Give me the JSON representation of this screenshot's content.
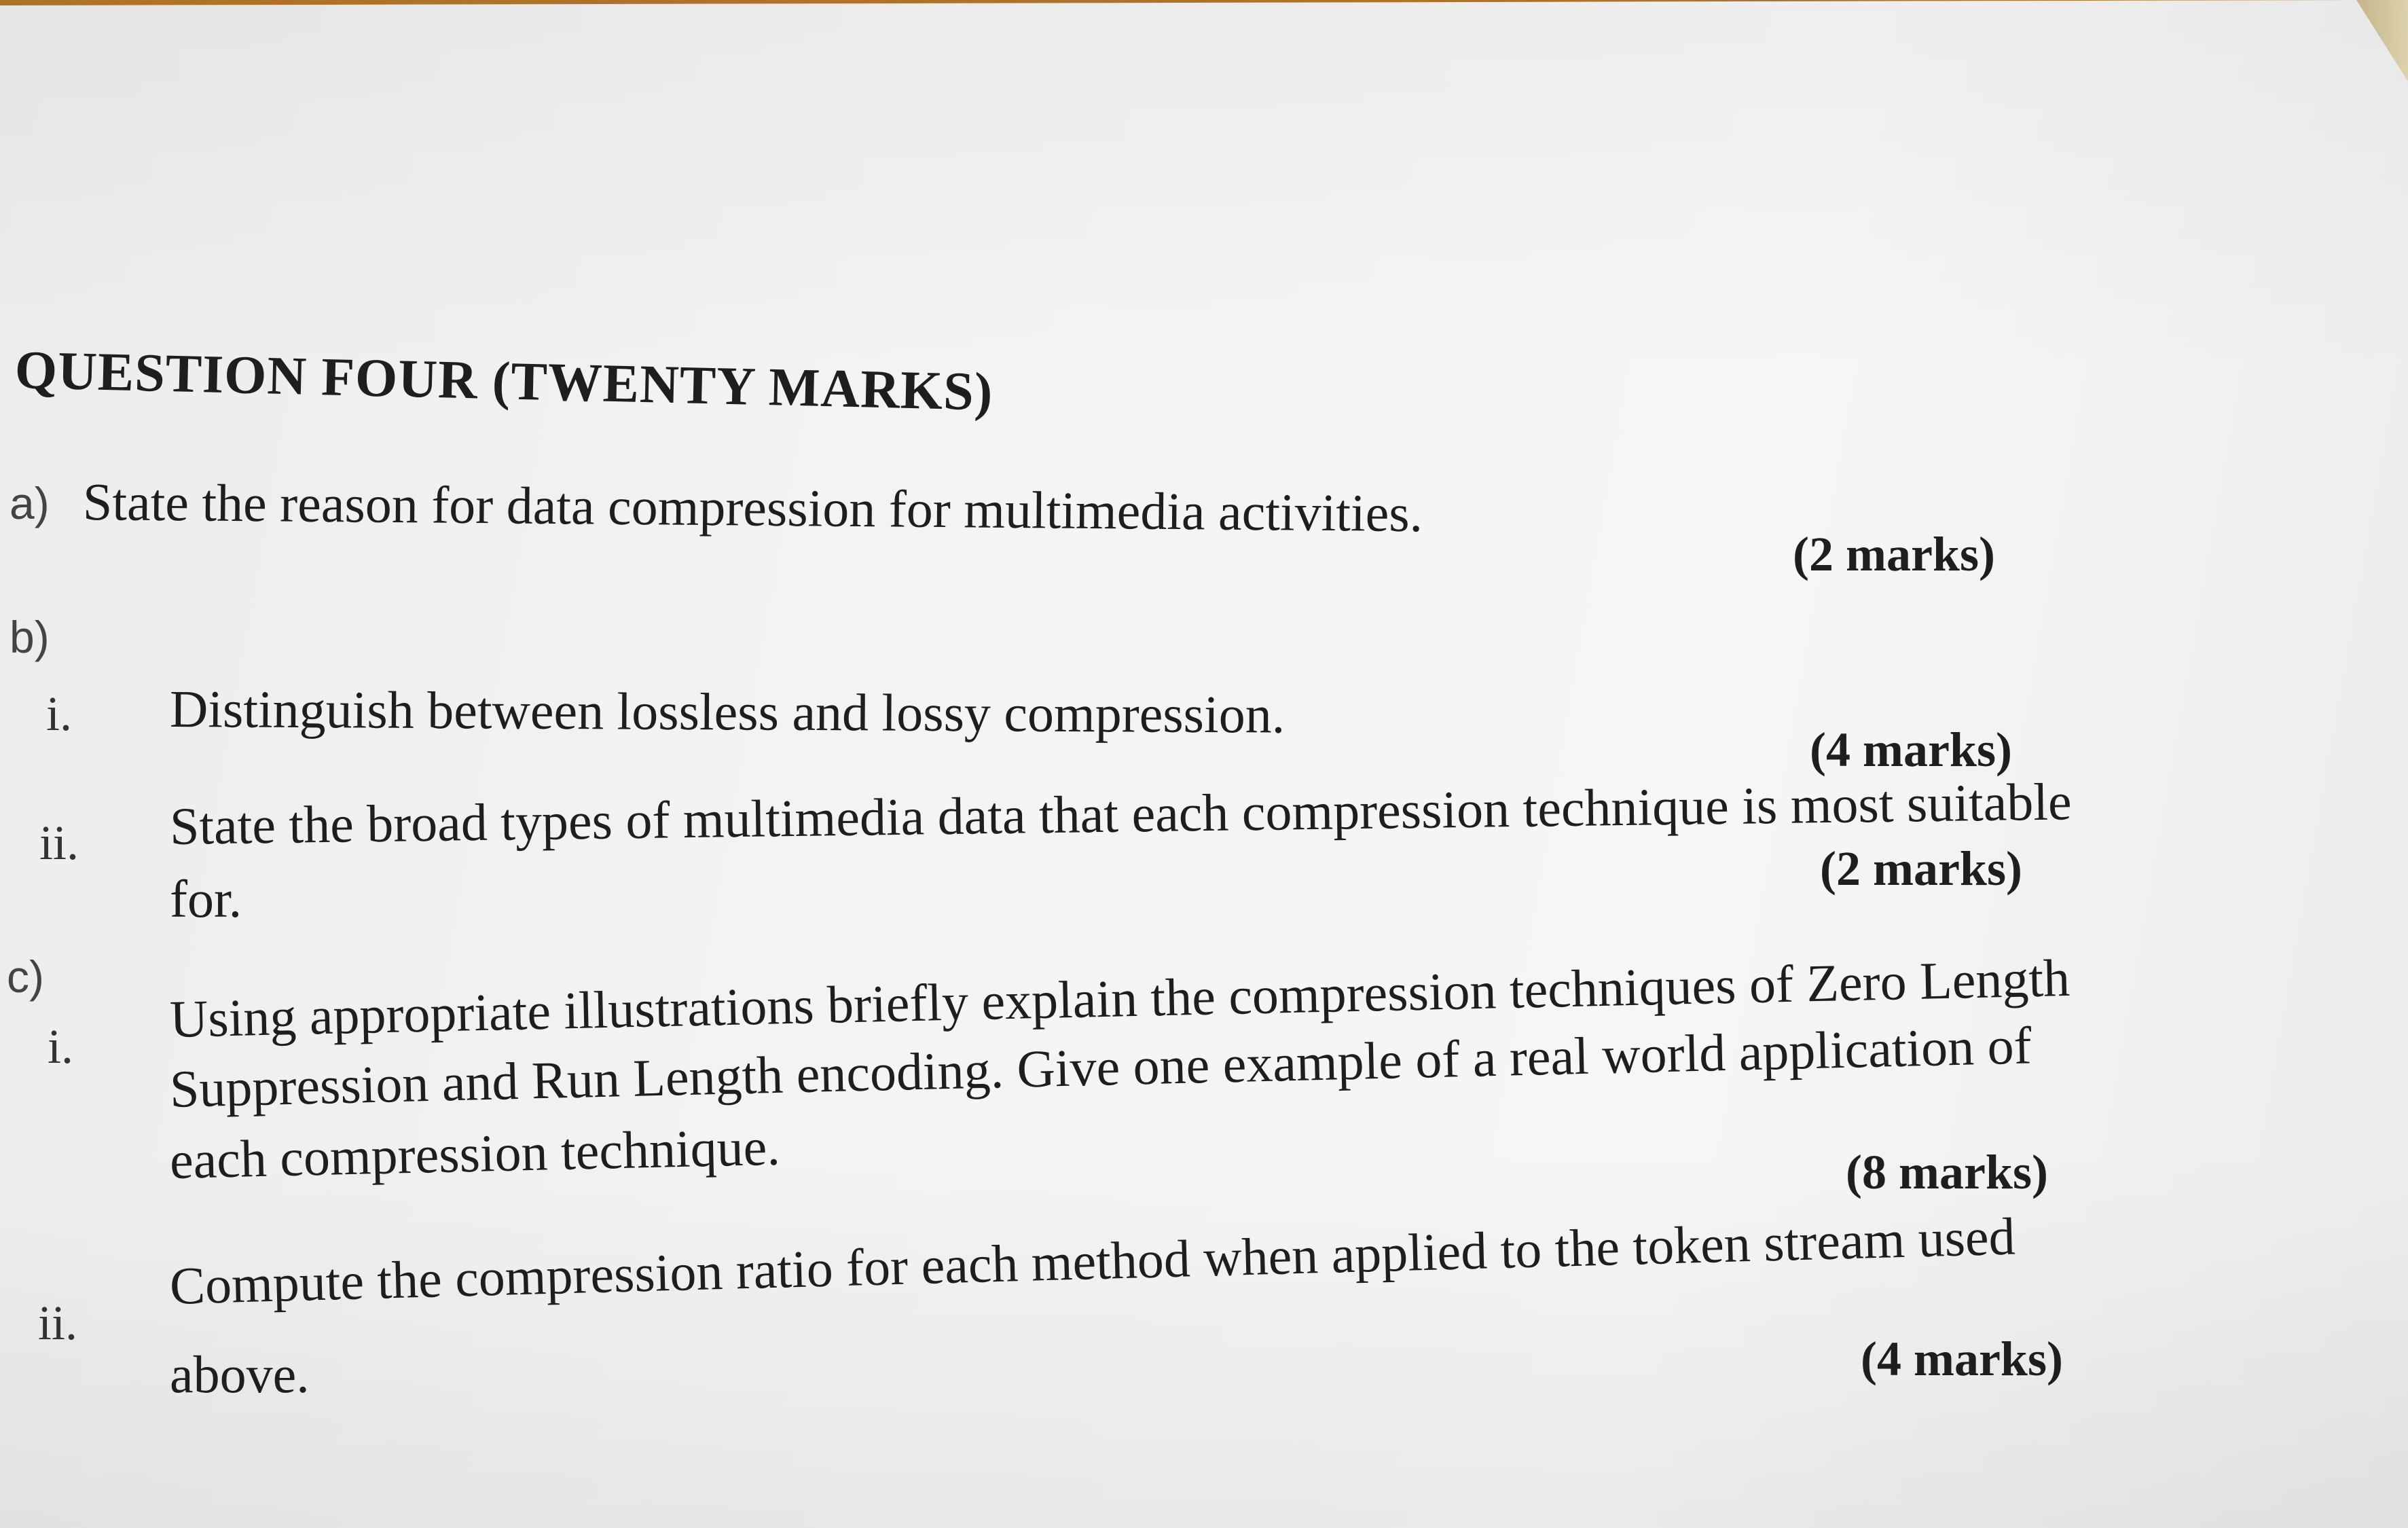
{
  "heading": "QUESTION FOUR (TWENTY MARKS)",
  "part_a": {
    "label": "a)",
    "text": "State the reason for data compression for multimedia activities.",
    "marks": "(2 marks)"
  },
  "part_b": {
    "label": "b)",
    "i": {
      "num": "i.",
      "text": "Distinguish between lossless and lossy compression.",
      "marks": "(4 marks)"
    },
    "ii": {
      "num": "ii.",
      "line1": "State the broad types of multimedia data that each compression technique is most suitable",
      "line2": "for.",
      "marks": "(2 marks)"
    }
  },
  "part_c": {
    "label": "c)",
    "i": {
      "num": "i.",
      "line1": "Using appropriate illustrations briefly explain the compression techniques of Zero Length",
      "line2": "Suppression and Run Length encoding. Give one example of a real world application of",
      "line3": "each compression technique.",
      "marks": "(8 marks)"
    },
    "ii": {
      "num": "ii.",
      "line1": "Compute the compression ratio for each method when applied to the token stream used",
      "line2": "above.",
      "marks": "(4 marks)"
    }
  }
}
